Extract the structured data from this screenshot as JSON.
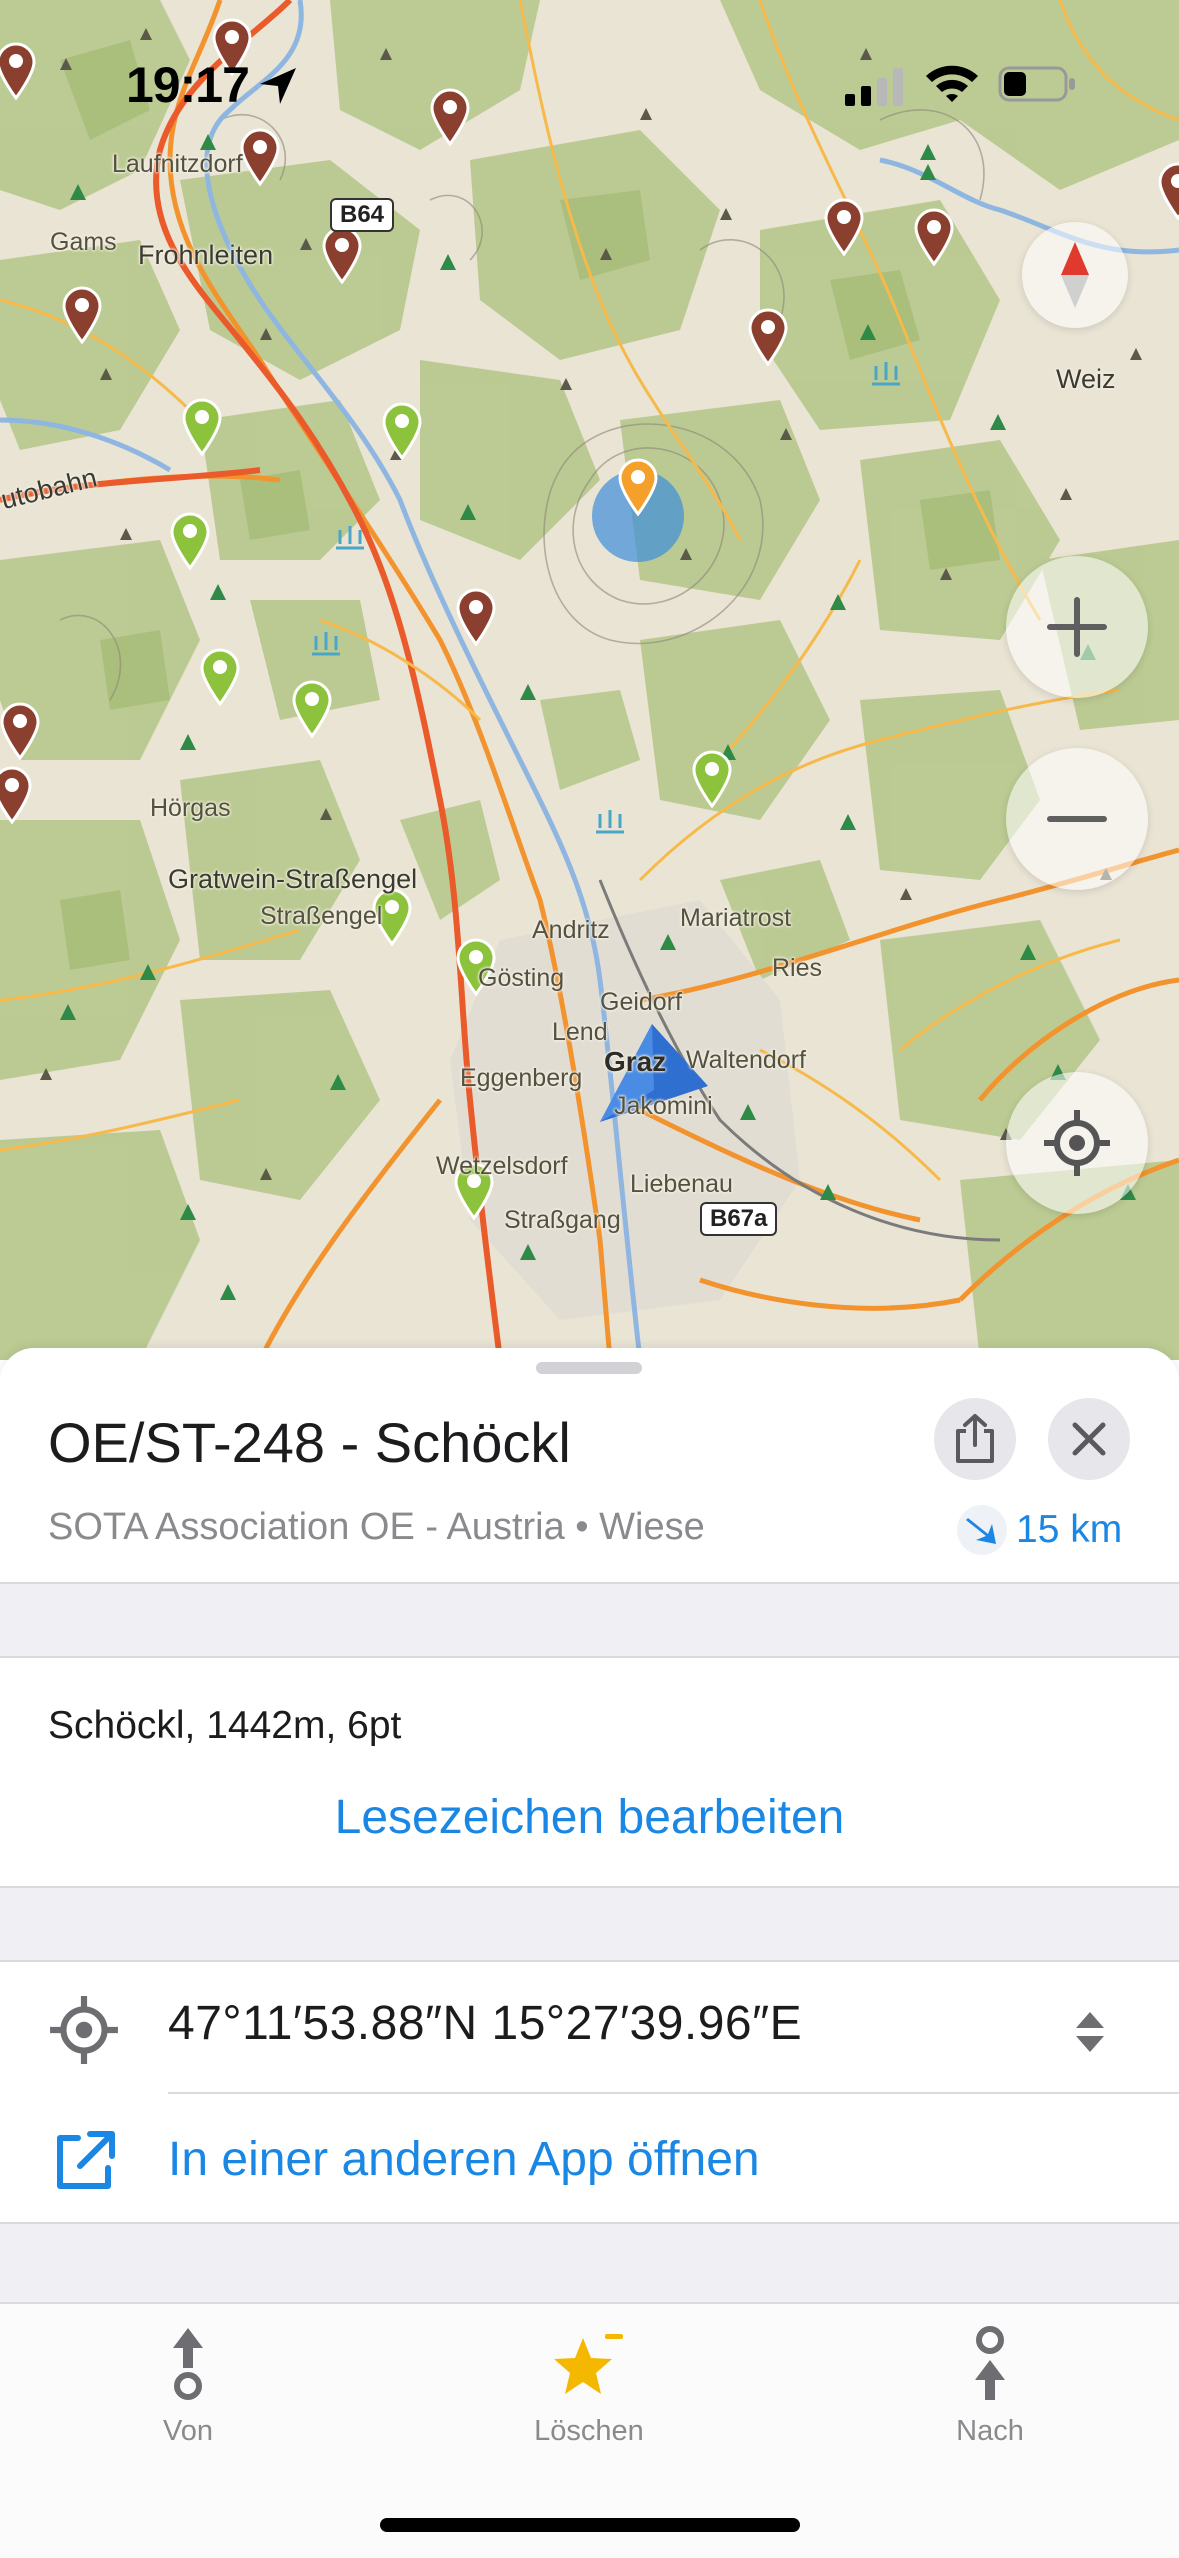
{
  "status_bar": {
    "time": "19:17"
  },
  "map": {
    "labels": {
      "laufnitzdorf": "Laufnitzdorf",
      "gams": "Gams",
      "frohnleiten": "Frohnleiten",
      "weiz": "Weiz",
      "autobahn": "utobahn",
      "horgas": "Hörgas",
      "gratwein": "Gratwein-Straßengel",
      "strassengel": "Straßengel",
      "andritz": "Andritz",
      "mariatrost": "Mariatrost",
      "ries": "Ries",
      "gosting": "Gösting",
      "geidorf": "Geidorf",
      "lend": "Lend",
      "graz": "Graz",
      "waltendorf": "Waltendorf",
      "eggenberg": "Eggenberg",
      "jakomini": "Jakomini",
      "wetzelsdorf": "Wetzelsdorf",
      "liebenau": "Liebenau",
      "strassgang": "Straßgang"
    },
    "shields": {
      "b64": "B64",
      "b67a": "B67a"
    }
  },
  "poi": {
    "title": "OE/ST-248 - Schöckl",
    "subtitle": "SOTA Association OE - Austria • Wiese",
    "distance": "15 km",
    "description": "Schöckl, 1442m, 6pt",
    "edit_bookmark": "Lesezeichen bearbeiten",
    "coordinates": "47°11′53.88″N 15°27′39.96″E",
    "open_in_app": "In einer anderen App öffnen"
  },
  "tabs": {
    "from": "Von",
    "delete": "Löschen",
    "to": "Nach"
  },
  "colors": {
    "accent": "#1a87e5",
    "bookmark_star": "#f5b800"
  }
}
